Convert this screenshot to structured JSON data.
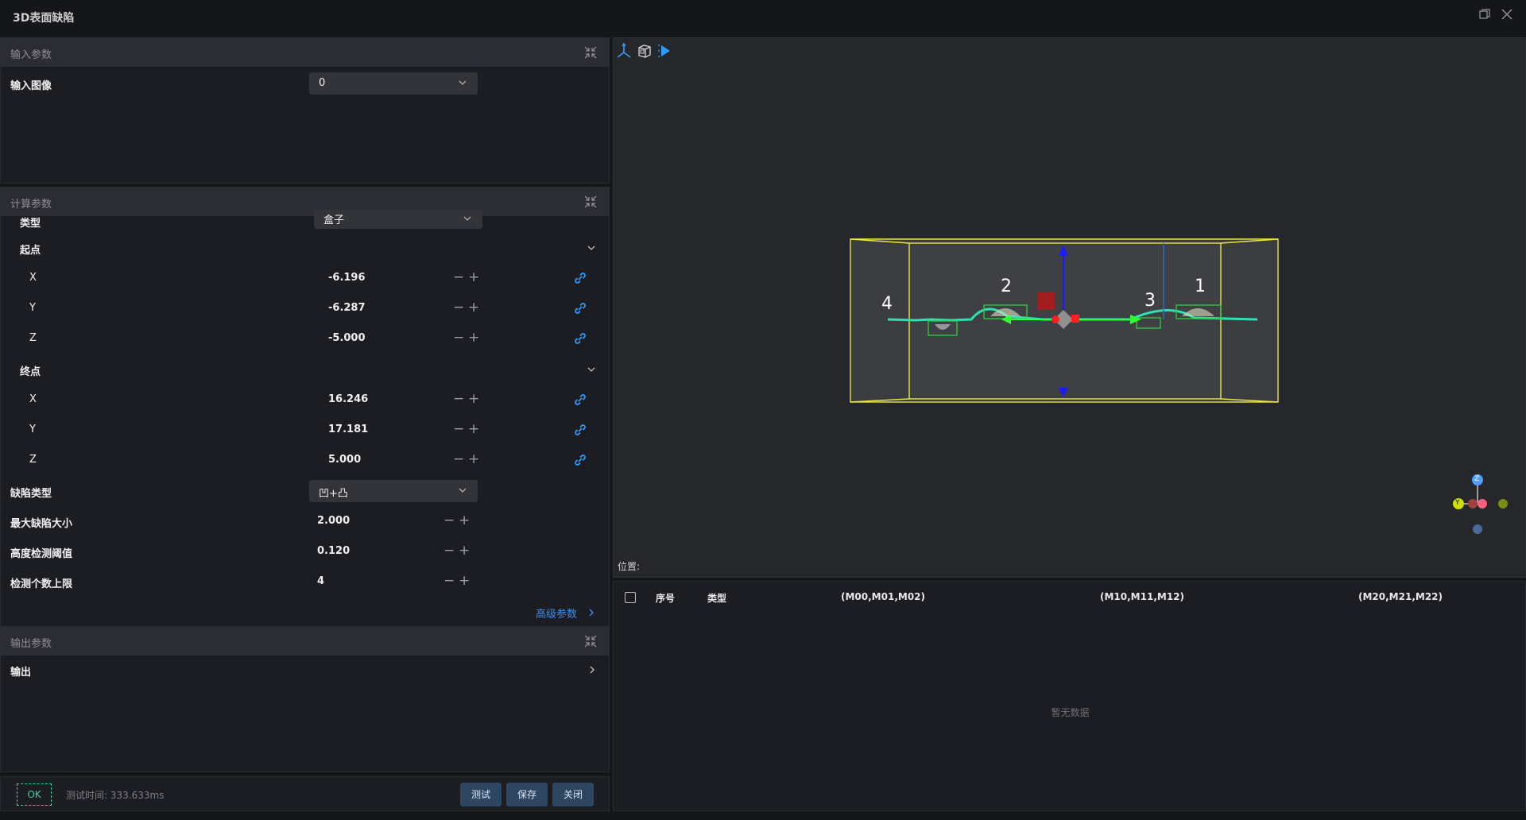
{
  "window": {
    "title": "3D表面缺陷"
  },
  "input_section": {
    "header": "输入参数",
    "input_image_label": "输入图像",
    "input_image_value": "0"
  },
  "calc_section": {
    "header": "计算参数",
    "type_label": "类型",
    "type_value": "盒子",
    "start_label": "起点",
    "start": {
      "x_label": "X",
      "x": "-6.196",
      "y_label": "Y",
      "y": "-6.287",
      "z_label": "Z",
      "z": "-5.000"
    },
    "end_label": "终点",
    "end": {
      "x_label": "X",
      "x": "16.246",
      "y_label": "Y",
      "y": "17.181",
      "z_label": "Z",
      "z": "5.000"
    },
    "defect_type_label": "缺陷类型",
    "defect_type_value": "凹+凸",
    "max_defect_label": "最大缺陷大小",
    "max_defect_value": "2.000",
    "height_thresh_label": "高度检测阈值",
    "height_thresh_value": "0.120",
    "max_count_label": "检测个数上限",
    "max_count_value": "4",
    "advanced_label": "高级参数"
  },
  "output_section": {
    "header": "输出参数",
    "output_label": "输出"
  },
  "footer": {
    "ok": "OK",
    "test_time": "测试时间: 333.633ms",
    "test_btn": "测试",
    "save_btn": "保存",
    "close_btn": "关闭"
  },
  "viewer": {
    "position_label": "位置:",
    "defect_labels": [
      "4",
      "2",
      "3",
      "1"
    ],
    "gizmo": {
      "z": "Z",
      "y": "Y"
    },
    "colors": {
      "box": "#e8e83a",
      "profile": "#2ee0b0",
      "defect": "#2ecc40",
      "axis_z": "#1a1aff",
      "axis_x": "#ff2020"
    }
  },
  "table": {
    "columns": [
      "序号",
      "类型",
      "(M00,M01,M02)",
      "(M10,M11,M12)",
      "(M20,M21,M22)"
    ],
    "empty_text": "暂无数据"
  }
}
